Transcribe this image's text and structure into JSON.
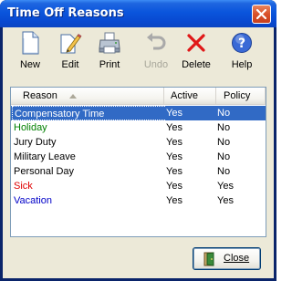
{
  "window": {
    "title": "Time Off Reasons"
  },
  "toolbar": {
    "new": "New",
    "edit": "Edit",
    "print": "Print",
    "undo": "Undo",
    "delete": "Delete",
    "help": "Help"
  },
  "list": {
    "columns": [
      "Reason",
      "Active",
      "Policy"
    ],
    "rows": [
      {
        "reason": "Compensatory Time",
        "active": "Yes",
        "policy": "No",
        "color": "#ffffff",
        "selected": true
      },
      {
        "reason": "Holiday",
        "active": "Yes",
        "policy": "No",
        "color": "#008000"
      },
      {
        "reason": "Jury Duty",
        "active": "Yes",
        "policy": "No",
        "color": "#000000"
      },
      {
        "reason": "Military Leave",
        "active": "Yes",
        "policy": "No",
        "color": "#000000"
      },
      {
        "reason": "Personal Day",
        "active": "Yes",
        "policy": "No",
        "color": "#000000"
      },
      {
        "reason": "Sick",
        "active": "Yes",
        "policy": "Yes",
        "color": "#e00000"
      },
      {
        "reason": "Vacation",
        "active": "Yes",
        "policy": "Yes",
        "color": "#0000c8"
      }
    ]
  },
  "footer": {
    "close": "Close"
  },
  "colors": {
    "titlebar": "#0a55dc",
    "selection": "#316ac5",
    "face": "#ece9d8"
  }
}
